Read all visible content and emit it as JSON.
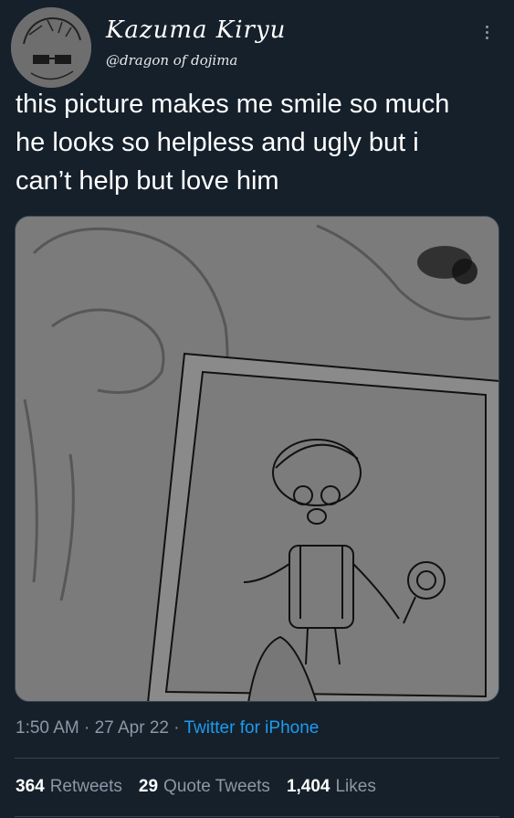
{
  "user": {
    "display_name": "Kazuma Kiryu",
    "handle": "@dragon of dojima"
  },
  "tweet": {
    "text_lines": [
      "this picture makes me smile so much",
      "he looks so helpless and ugly but i",
      "can’t help but love him"
    ]
  },
  "meta": {
    "time": "1:50 AM",
    "separator": "·",
    "date": "27 Apr 22",
    "source": "Twitter for iPhone"
  },
  "stats": [
    {
      "count": "364",
      "label": "Retweets"
    },
    {
      "count": "29",
      "label": "Quote Tweets"
    },
    {
      "count": "1,404",
      "label": "Likes"
    }
  ],
  "icons": {
    "more": "more-vertical-icon"
  },
  "colors": {
    "background": "#15202b",
    "text": "#ffffff",
    "muted": "#8b98a5",
    "link": "#1d9bf0",
    "divider": "#38444d"
  }
}
